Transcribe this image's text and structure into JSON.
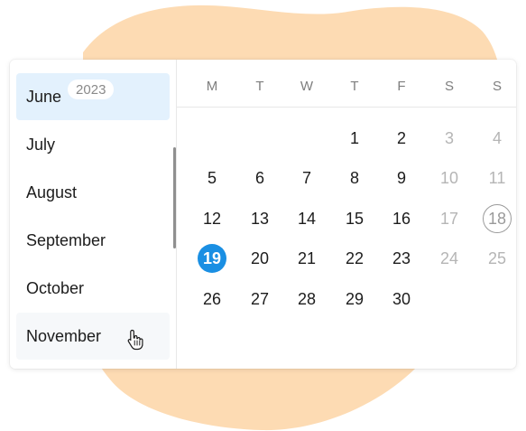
{
  "months": {
    "year_badge": "2023",
    "items": [
      {
        "label": "June",
        "state": "selected"
      },
      {
        "label": "July",
        "state": "normal"
      },
      {
        "label": "August",
        "state": "normal"
      },
      {
        "label": "September",
        "state": "normal"
      },
      {
        "label": "October",
        "state": "normal"
      },
      {
        "label": "November",
        "state": "hovered"
      }
    ]
  },
  "calendar": {
    "weekdays": [
      "M",
      "T",
      "W",
      "T",
      "F",
      "S",
      "S"
    ],
    "weeks": [
      [
        "",
        "",
        "",
        "1",
        "2",
        "3",
        "4"
      ],
      [
        "5",
        "6",
        "7",
        "8",
        "9",
        "10",
        "11"
      ],
      [
        "12",
        "13",
        "14",
        "15",
        "16",
        "17",
        "18"
      ],
      [
        "19",
        "20",
        "21",
        "22",
        "23",
        "24",
        "25"
      ],
      [
        "26",
        "27",
        "28",
        "29",
        "30",
        "",
        ""
      ]
    ],
    "selected_day": "19",
    "today": "18"
  },
  "colors": {
    "accent": "#1a8fe3",
    "selected_month_bg": "#e3f1fd",
    "blob": "#fddbb3",
    "weekend_text": "#b5b5b5"
  },
  "icons": {
    "cursor": "hand-pointer-icon"
  }
}
